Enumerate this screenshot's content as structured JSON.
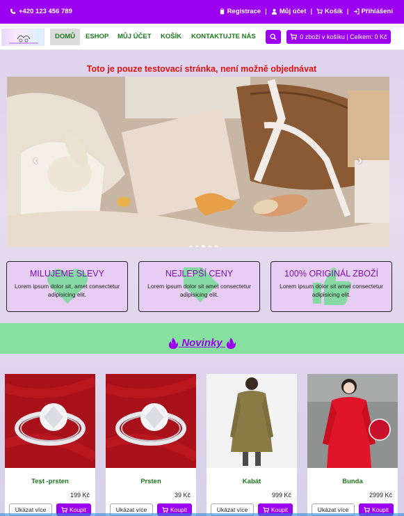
{
  "topbar": {
    "phone": "+420 123 456 789",
    "links": [
      {
        "label": "Registrace",
        "icon": "clipboard-icon"
      },
      {
        "label": "Můj účet",
        "icon": "user-icon"
      },
      {
        "label": "Košík",
        "icon": "cart-icon"
      },
      {
        "label": "Přihlášení",
        "icon": "login-icon"
      }
    ]
  },
  "nav": {
    "items": [
      "DOMŮ",
      "ESHOP",
      "MŮJ ÚČET",
      "KOŠÍK",
      "KONTAKTUJTE NÁS"
    ],
    "active": "DOMŮ",
    "cart_summary": "0 zboží v košíku | Celkem: 0 Kč"
  },
  "hero": {
    "notice": "Toto je pouze testovací stránka, není možně objednávat",
    "slide_count": 5,
    "active_slide": 3
  },
  "features": [
    {
      "title": "MILUJEME SLEVY",
      "text": "Lorem ipsum dolor sit, amet consectetur adipisicing elit.",
      "icon": "heart-icon"
    },
    {
      "title": "NEJLEPŠÍ CENY",
      "text": "Lorem ipsum dolor sit amet consectetur adipisicing elit.",
      "icon": "tag-icon"
    },
    {
      "title": "100% ORIGINÁL ZBOŽÍ",
      "text": "Lorem ipsum dolor sit amet consectetur adipisicing elit.",
      "icon": "thumbs-up-icon"
    }
  ],
  "section": {
    "title": "Novinky"
  },
  "products": [
    {
      "name": "Test -prsten",
      "price": "199 Kč",
      "more": "Ukázat více",
      "buy": "Koupit"
    },
    {
      "name": "Prsten",
      "price": "39 Kč",
      "more": "Ukázat více",
      "buy": "Koupit"
    },
    {
      "name": "Kabát",
      "price": "999 Kč",
      "more": "Ukázat více",
      "buy": "Koupit"
    },
    {
      "name": "Bunda",
      "price": "2999 Kč",
      "more": "Ukázat více",
      "buy": "Koupit"
    }
  ],
  "colors": {
    "brand": "#9b00f0",
    "nav_text": "#1a7a1a",
    "band": "#86e0a0",
    "notice": "#e01010"
  }
}
